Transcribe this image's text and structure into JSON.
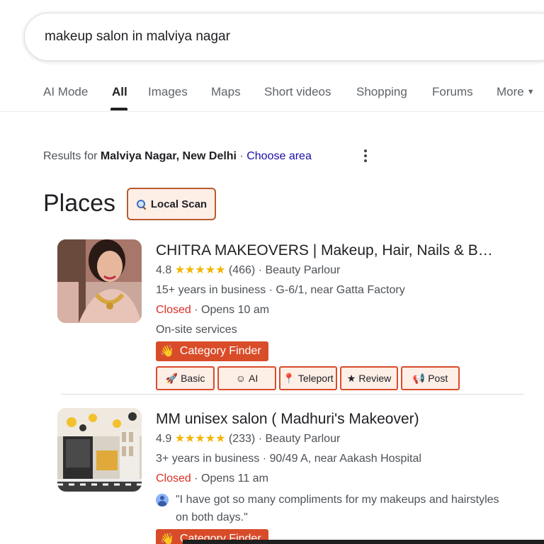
{
  "search": {
    "query": "makeup salon in malviya nagar"
  },
  "tabs": [
    {
      "label": "AI Mode"
    },
    {
      "label": "All"
    },
    {
      "label": "Images"
    },
    {
      "label": "Maps"
    },
    {
      "label": "Short videos"
    },
    {
      "label": "Shopping"
    },
    {
      "label": "Forums"
    },
    {
      "label": "More"
    }
  ],
  "location": {
    "prefix": "Results for ",
    "place": "Malviya Nagar, New Delhi",
    "separator": " · ",
    "choose_area": "Choose area"
  },
  "places": {
    "title": "Places",
    "local_scan": "Local Scan",
    "listings": [
      {
        "name": "CHITRA MAKEOVERS | Makeup, Hair, Nails & B…",
        "rating": "4.8",
        "stars": "★★★★★",
        "reviews": "(466)",
        "category": "· Beauty Parlour",
        "details": "15+ years in business · G-6/1, near Gatta Factory",
        "status": "Closed",
        "opens": "· Opens 10 am",
        "extra": "On-site services",
        "category_finder": "Category Finder",
        "tools": [
          {
            "icon": "🚀",
            "label": "Basic"
          },
          {
            "icon": "☺",
            "label": "AI"
          },
          {
            "icon": "📍",
            "label": "Teleport"
          },
          {
            "icon": "★",
            "label": "Review"
          },
          {
            "icon": "📢",
            "label": "Post"
          }
        ]
      },
      {
        "name": "MM unisex salon ( Madhuri's Makeover)",
        "rating": "4.9",
        "stars": "★★★★★",
        "reviews": "(233)",
        "category": "· Beauty Parlour",
        "details": "3+ years in business · 90/49 A, near Aakash Hospital",
        "status": "Closed",
        "opens": "· Opens 11 am",
        "review": "\"I have got so many compliments for my makeups and hairstyles on both days.\"",
        "category_finder": "Category Finder"
      }
    ]
  },
  "colors": {
    "accent_red": "#d94c2a",
    "closed_red": "#d93025",
    "star": "#f4b400",
    "link_blue": "#1a0dab"
  }
}
